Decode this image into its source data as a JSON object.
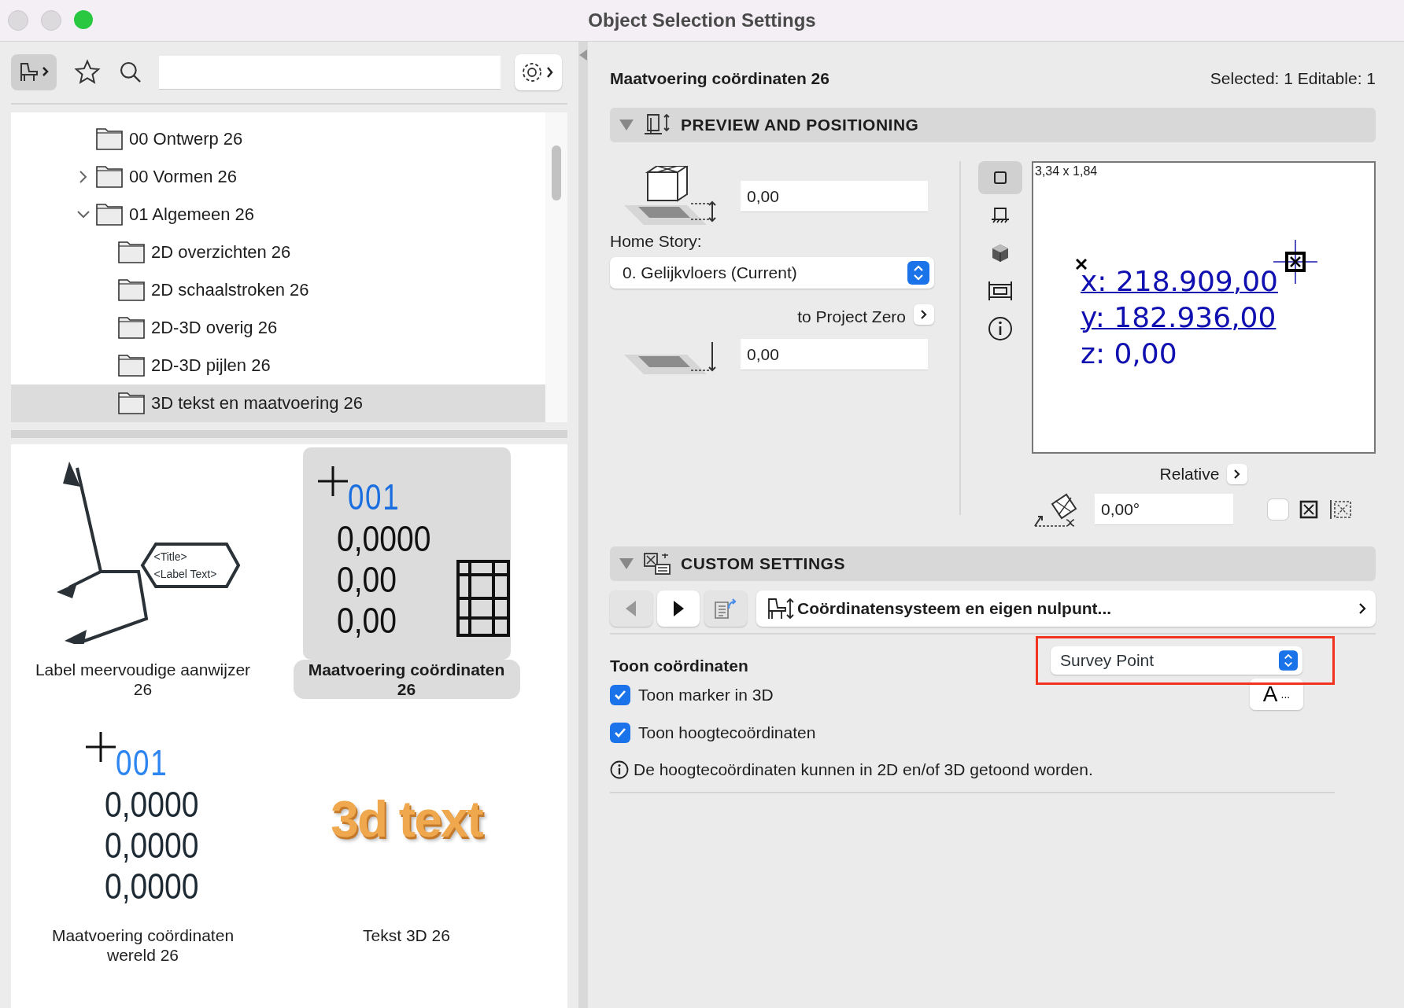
{
  "window": {
    "title": "Object Selection Settings"
  },
  "folders": [
    {
      "label": "00 Ontwerp 26",
      "kind": "leaf",
      "selected": false
    },
    {
      "label": "00 Vormen 26",
      "kind": "branch",
      "expanded": false,
      "selected": false
    },
    {
      "label": "01 Algemeen 26",
      "kind": "branch",
      "expanded": true,
      "selected": false,
      "children": [
        {
          "label": "2D overzichten 26",
          "selected": false
        },
        {
          "label": "2D schaalstroken 26",
          "selected": false
        },
        {
          "label": "2D-3D overig 26",
          "selected": false
        },
        {
          "label": "2D-3D pijlen 26",
          "selected": false
        },
        {
          "label": "3D tekst en maatvoering 26",
          "selected": true
        }
      ]
    }
  ],
  "library_items": [
    {
      "label": "Label meervoudige aanwijzer 26",
      "kind": "pointer",
      "selected": false,
      "preview_lines": [
        "<Title>",
        "<Label Text>"
      ]
    },
    {
      "label": "Maatvoering coördinaten 26",
      "kind": "coordinates",
      "selected": true,
      "index": "001",
      "preview_lines": [
        "0,0000",
        "0,00",
        "0,00"
      ]
    },
    {
      "label": "Maatvoering coördinaten wereld 26",
      "kind": "world",
      "selected": false,
      "index": "001",
      "preview_lines": [
        "0,0000",
        "0,0000",
        "0,0000"
      ]
    },
    {
      "label": "Tekst 3D 26",
      "kind": "text3d",
      "selected": false,
      "preview_lines": [
        "3d text"
      ]
    }
  ],
  "header": {
    "title": "Maatvoering coördinaten 26",
    "selection": "Selected: 1 Editable: 1"
  },
  "preview_section": {
    "title": "PREVIEW AND POSITIONING",
    "expanded": true,
    "elevation": "0,00",
    "home_story_label": "Home Story:",
    "home_story": "0. Gelijkvloers (Current)",
    "reference": "to Project Zero",
    "reference_elevation": "0,00",
    "view_buttons": [
      {
        "kind": "plan",
        "selected": true
      },
      {
        "kind": "section",
        "selected": false
      },
      {
        "kind": "model",
        "selected": false
      },
      {
        "kind": "elevation",
        "selected": false
      },
      {
        "kind": "info",
        "selected": false
      }
    ],
    "size": "3,34 x 1,84",
    "coordinates": [
      "x: 218.909,00",
      "y: 182.936,00",
      "z: 0,00"
    ],
    "relative": "Relative",
    "angle": "0,00°",
    "mirrored": false
  },
  "custom_section": {
    "title": "CUSTOM SETTINGS",
    "expanded": true,
    "page": "Coördinatensysteem en eigen nulpunt...",
    "group_label": "Toon coördinaten",
    "dropdown": "Survey Point",
    "highlighted": true,
    "font_button": {
      "glyph": "A",
      "ellipsis": "..."
    },
    "checkboxes": [
      {
        "label": "Toon marker in 3D",
        "checked": true
      },
      {
        "label": "Toon hoogtecoördinaten",
        "checked": true
      }
    ],
    "note": "De hoogtecoördinaten kunnen in 2D en/of 3D getoond worden."
  }
}
